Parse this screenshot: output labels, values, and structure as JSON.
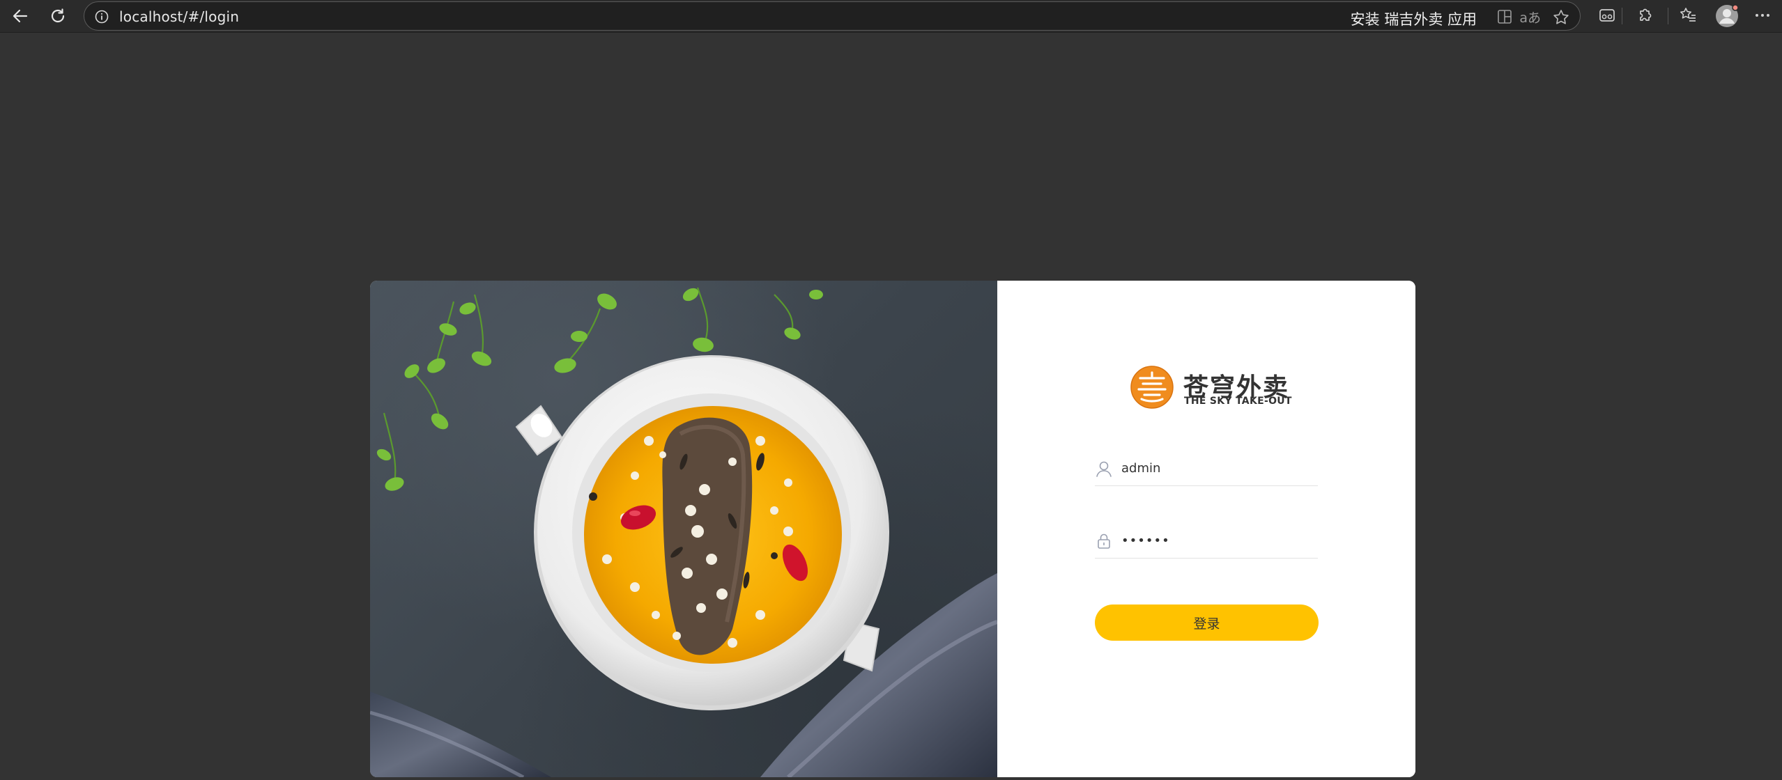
{
  "browser": {
    "url": "localhost/#/login",
    "install_prompt": "安装 瑞吉外卖 应用",
    "icons": {
      "back": "back-arrow-icon",
      "reload": "reload-icon",
      "info": "site-info-icon",
      "app_available": "app-available-icon",
      "read_aloud": "read-aloud-icon",
      "favorite": "favorite-star-icon",
      "split_screen": "split-screen-icon",
      "extensions": "extensions-puzzle-icon",
      "favorites": "favorites-list-icon",
      "profile": "profile-avatar-icon",
      "menu": "more-menu-icon"
    },
    "read_aloud_label": "aあ"
  },
  "login": {
    "brand_cn": "苍穹外卖",
    "brand_en": "THE SKY TAKE-OUT",
    "username_value": "admin",
    "password_value": "••••••",
    "submit_label": "登录",
    "accent_color": "#ffc200",
    "logo_color": "#f08c1e"
  }
}
